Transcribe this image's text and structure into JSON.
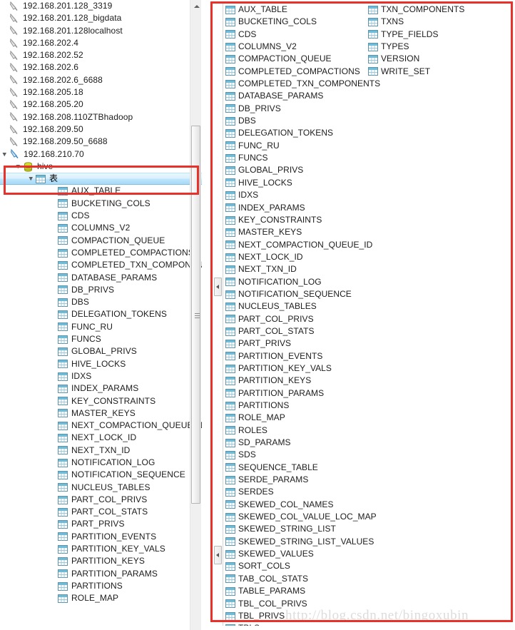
{
  "app": {
    "title": "Database Navigator Tree",
    "accent_color": "#e8312a",
    "selection_color": "#bee6fd",
    "table_icon_color": "#4f9fc0"
  },
  "left_panel": {
    "name": "connection-tree",
    "connections": [
      {
        "label": "192.168.201.128_3319",
        "icon": "connection-icon"
      },
      {
        "label": "192.168.201.128_bigdata",
        "icon": "connection-icon"
      },
      {
        "label": "192.168.201.128localhost",
        "icon": "connection-icon"
      },
      {
        "label": "192.168.202.4",
        "icon": "connection-icon"
      },
      {
        "label": "192.168.202.52",
        "icon": "connection-icon"
      },
      {
        "label": "192.168.202.6",
        "icon": "connection-icon"
      },
      {
        "label": "192.168.202.6_6688",
        "icon": "connection-icon"
      },
      {
        "label": "192.168.205.18",
        "icon": "connection-icon"
      },
      {
        "label": "192.168.205.20",
        "icon": "connection-icon"
      },
      {
        "label": "192.168.208.110ZTBhadoop",
        "icon": "connection-icon"
      },
      {
        "label": "192.168.209.50",
        "icon": "connection-icon"
      },
      {
        "label": "192.168.209.50_6688",
        "icon": "connection-icon"
      }
    ],
    "expanded_connection": {
      "label": "192.168.210.70",
      "icon": "connection-icon"
    },
    "schema": {
      "label": "hive",
      "icon": "database-icon"
    },
    "tables_node": {
      "label": "表",
      "icon": "table-folder-icon",
      "selected": true
    },
    "tables": [
      "AUX_TABLE",
      "BUCKETING_COLS",
      "CDS",
      "COLUMNS_V2",
      "COMPACTION_QUEUE",
      "COMPLETED_COMPACTIONS",
      "COMPLETED_TXN_COMPONENTS",
      "DATABASE_PARAMS",
      "DB_PRIVS",
      "DBS",
      "DELEGATION_TOKENS",
      "FUNC_RU",
      "FUNCS",
      "GLOBAL_PRIVS",
      "HIVE_LOCKS",
      "IDXS",
      "INDEX_PARAMS",
      "KEY_CONSTRAINTS",
      "MASTER_KEYS",
      "NEXT_COMPACTION_QUEUE_ID",
      "NEXT_LOCK_ID",
      "NEXT_TXN_ID",
      "NOTIFICATION_LOG",
      "NOTIFICATION_SEQUENCE",
      "NUCLEUS_TABLES",
      "PART_COL_PRIVS",
      "PART_COL_STATS",
      "PART_PRIVS",
      "PARTITION_EVENTS",
      "PARTITION_KEY_VALS",
      "PARTITION_KEYS",
      "PARTITION_PARAMS",
      "PARTITIONS",
      "ROLE_MAP"
    ]
  },
  "right_panel": {
    "name": "table-list-popup",
    "column_a": [
      "AUX_TABLE",
      "BUCKETING_COLS",
      "CDS",
      "COLUMNS_V2",
      "COMPACTION_QUEUE",
      "COMPLETED_COMPACTIONS",
      "COMPLETED_TXN_COMPONENTS",
      "DATABASE_PARAMS",
      "DB_PRIVS",
      "DBS",
      "DELEGATION_TOKENS",
      "FUNC_RU",
      "FUNCS",
      "GLOBAL_PRIVS",
      "HIVE_LOCKS",
      "IDXS",
      "INDEX_PARAMS",
      "KEY_CONSTRAINTS",
      "MASTER_KEYS",
      "NEXT_COMPACTION_QUEUE_ID",
      "NEXT_LOCK_ID",
      "NEXT_TXN_ID",
      "NOTIFICATION_LOG",
      "NOTIFICATION_SEQUENCE",
      "NUCLEUS_TABLES",
      "PART_COL_PRIVS",
      "PART_COL_STATS",
      "PART_PRIVS",
      "PARTITION_EVENTS",
      "PARTITION_KEY_VALS",
      "PARTITION_KEYS",
      "PARTITION_PARAMS",
      "PARTITIONS",
      "ROLE_MAP",
      "ROLES",
      "SD_PARAMS",
      "SDS",
      "SEQUENCE_TABLE",
      "SERDE_PARAMS",
      "SERDES",
      "SKEWED_COL_NAMES",
      "SKEWED_COL_VALUE_LOC_MAP",
      "SKEWED_STRING_LIST",
      "SKEWED_STRING_LIST_VALUES",
      "SKEWED_VALUES",
      "SORT_COLS",
      "TAB_COL_STATS",
      "TABLE_PARAMS",
      "TBL_COL_PRIVS",
      "TBL_PRIVS",
      "TBLS"
    ],
    "column_b": [
      "TXN_COMPONENTS",
      "TXNS",
      "TYPE_FIELDS",
      "TYPES",
      "VERSION",
      "WRITE_SET"
    ]
  },
  "watermark": {
    "text": "http://blog.csdn.net/bingoxubin"
  },
  "scrollbar": {
    "name": "left-vertical-scrollbar",
    "up_arrow": "chevron-up-icon",
    "thumb_position": "middle"
  }
}
